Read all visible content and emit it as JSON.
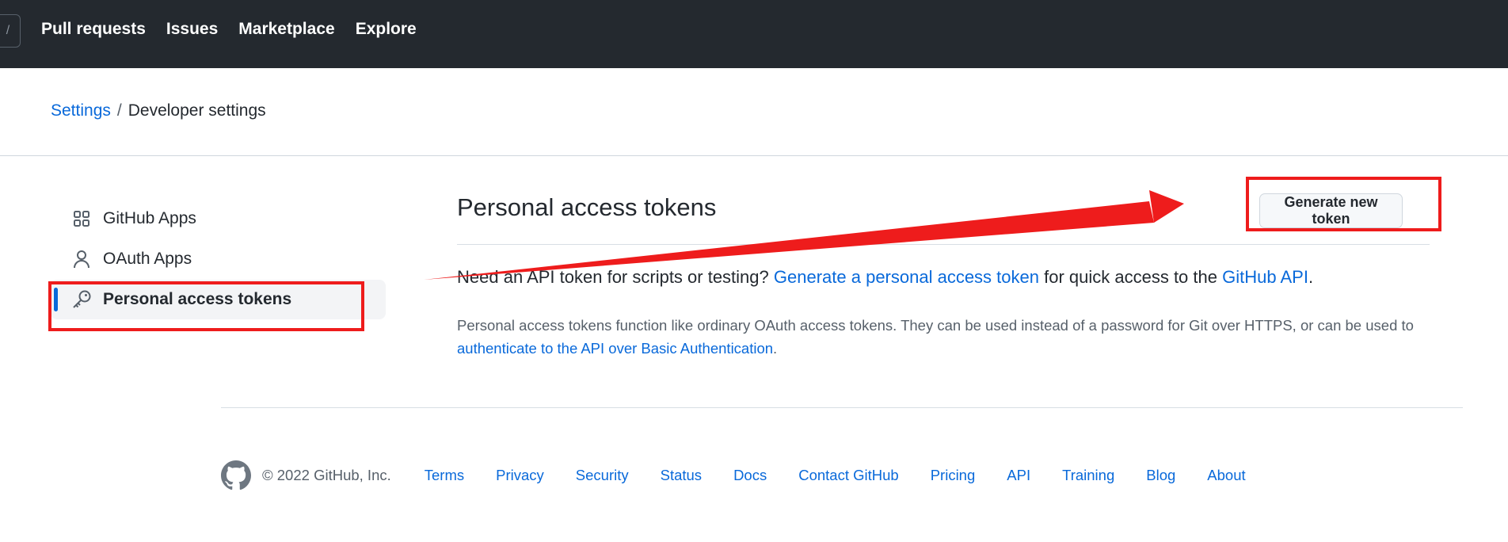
{
  "header": {
    "nav": [
      "Pull requests",
      "Issues",
      "Marketplace",
      "Explore"
    ],
    "slash_glyph": "/"
  },
  "breadcrumb": {
    "root": "Settings",
    "separator": "/",
    "current": "Developer settings"
  },
  "sidebar": {
    "items": [
      {
        "label": "GitHub Apps",
        "icon": "apps-grid-icon",
        "active": false
      },
      {
        "label": "OAuth Apps",
        "icon": "person-icon",
        "active": false
      },
      {
        "label": "Personal access tokens",
        "icon": "key-icon",
        "active": true
      }
    ]
  },
  "main": {
    "title": "Personal access tokens",
    "generate_button": "Generate new token",
    "lead_prefix": "Need an API token for scripts or testing?",
    "lead_link": "Generate a personal access token",
    "lead_middle": "for quick access to the",
    "lead_link2": "GitHub API",
    "lead_suffix": ".",
    "note_text": "Personal access tokens function like ordinary OAuth access tokens. They can be used instead of a password for Git over HTTPS, or can be used to",
    "note_link": "authenticate to the API over Basic Authentication",
    "note_suffix": "."
  },
  "footer": {
    "copyright": "© 2022 GitHub, Inc.",
    "links": [
      "Terms",
      "Privacy",
      "Security",
      "Status",
      "Docs",
      "Contact GitHub",
      "Pricing",
      "API",
      "Training",
      "Blog",
      "About"
    ]
  },
  "annotation": {
    "color": "#ee1c1c"
  },
  "colors": {
    "header_bg": "#24292f",
    "link": "#0969da",
    "text": "#24292f",
    "muted": "#57606a"
  }
}
